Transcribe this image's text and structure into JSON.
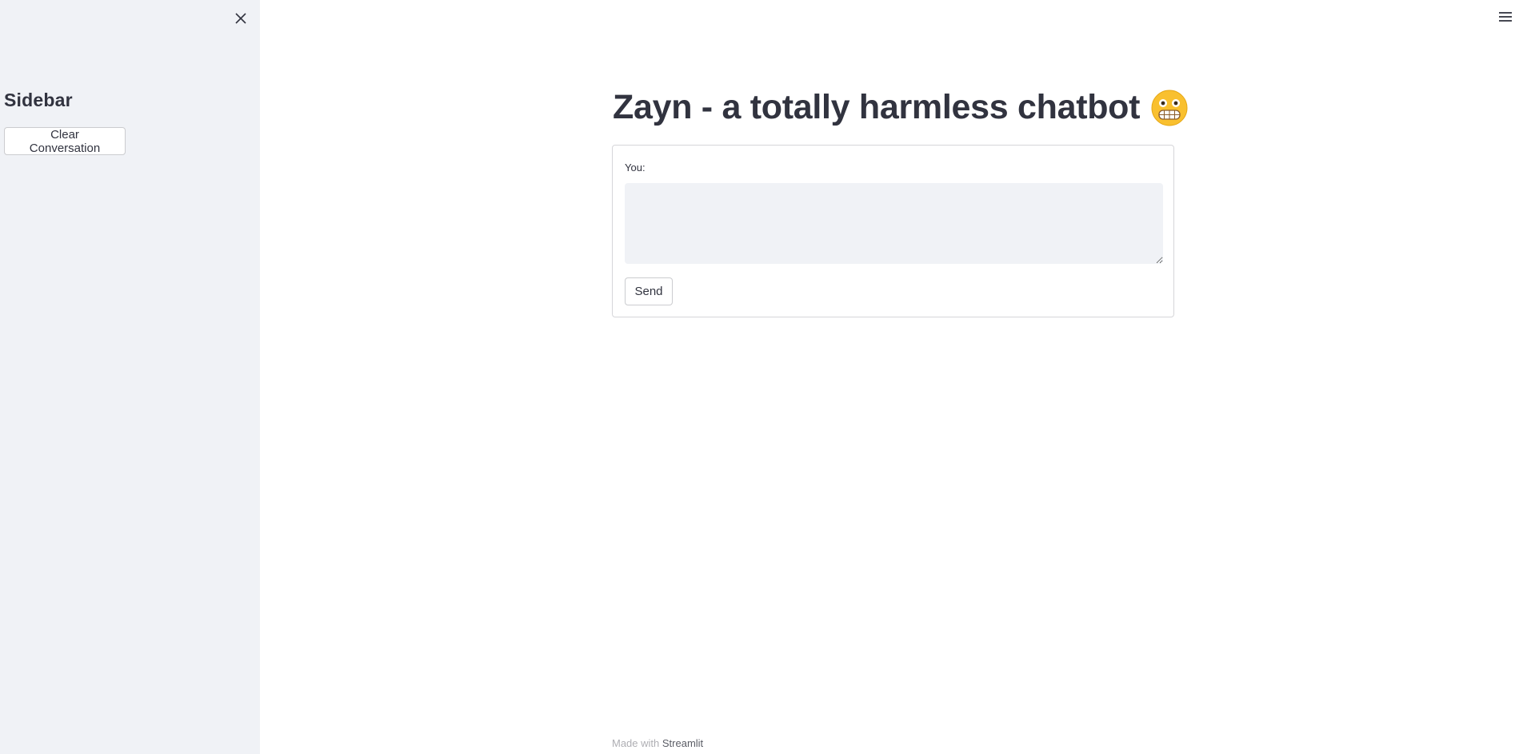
{
  "sidebar": {
    "title": "Sidebar",
    "clear_button_label": "Clear Conversation",
    "close_icon": "close-icon"
  },
  "header": {
    "menu_icon": "hamburger-menu-icon"
  },
  "main": {
    "title": "Zayn - a totally harmless chatbot",
    "title_emoji": "grimacing-face-icon",
    "form": {
      "input_label": "You:",
      "input_value": "",
      "send_label": "Send"
    }
  },
  "footer": {
    "prefix": "Made with",
    "link_text": "Streamlit"
  },
  "colors": {
    "sidebar_bg": "#f0f2f6",
    "text": "#31333f",
    "input_bg": "#f0f2f6"
  }
}
